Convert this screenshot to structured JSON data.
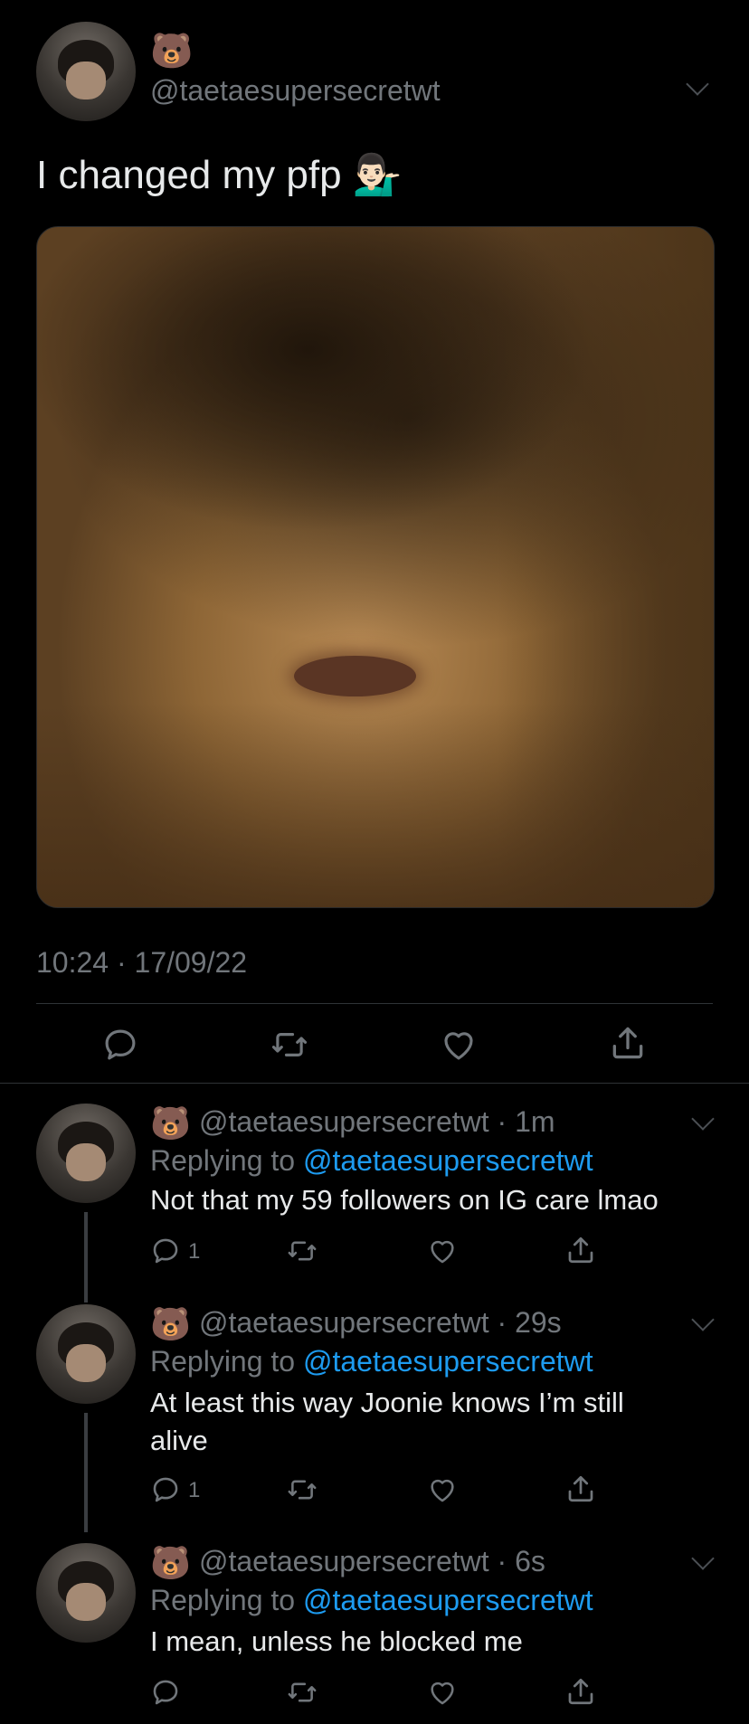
{
  "main_tweet": {
    "display_name_emoji": "🐻",
    "handle": "@taetaesupersecretwt",
    "text": "I changed my pfp 💁🏻‍♂️",
    "timestamp": "10:24 · 17/09/22"
  },
  "replies": [
    {
      "emoji": "🐻",
      "meta": "@taetaesupersecretwt · 1m",
      "replying_prefix": "Replying to ",
      "replying_to": "@taetaesupersecretwt",
      "text": "Not that my 59 followers on IG care lmao",
      "reply_count": "1"
    },
    {
      "emoji": "🐻",
      "meta": "@taetaesupersecretwt · 29s",
      "replying_prefix": "Replying to ",
      "replying_to": "@taetaesupersecretwt",
      "text": "At least this way Joonie knows I’m still alive",
      "reply_count": "1"
    },
    {
      "emoji": "🐻",
      "meta": "@taetaesupersecretwt · 6s",
      "replying_prefix": "Replying to ",
      "replying_to": "@taetaesupersecretwt",
      "text": "I mean, unless he blocked me",
      "reply_count": ""
    }
  ],
  "icons": [
    "reply-icon",
    "retweet-icon",
    "like-icon",
    "share-icon",
    "chevron-down-icon"
  ],
  "colors": {
    "background": "#000000",
    "text": "#e7e9ea",
    "muted": "#71767b",
    "link": "#1d9bf0",
    "divider": "#2f3336"
  }
}
